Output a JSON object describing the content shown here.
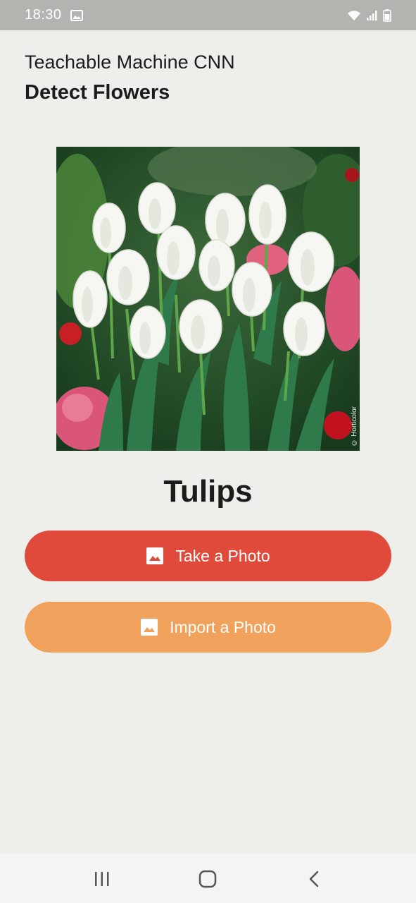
{
  "status_bar": {
    "time": "18:30",
    "icons": [
      "gallery-icon",
      "wifi-icon",
      "signal-icon",
      "battery-icon"
    ],
    "background": "#b3b3b0"
  },
  "header": {
    "subtitle": "Teachable Machine CNN",
    "title": "Detect Flowers"
  },
  "photo": {
    "description_icon": "tulips-photo",
    "watermark": "© Horticolor"
  },
  "result": {
    "label": "Tulips"
  },
  "buttons": {
    "take_photo": {
      "label": "Take a Photo",
      "icon": "image-icon",
      "color": "#e04a3b"
    },
    "import_photo": {
      "label": "Import a Photo",
      "icon": "image-icon",
      "color": "#f0a25c"
    }
  },
  "nav_bar": {
    "items": [
      "recents-icon",
      "home-icon",
      "back-icon"
    ]
  }
}
